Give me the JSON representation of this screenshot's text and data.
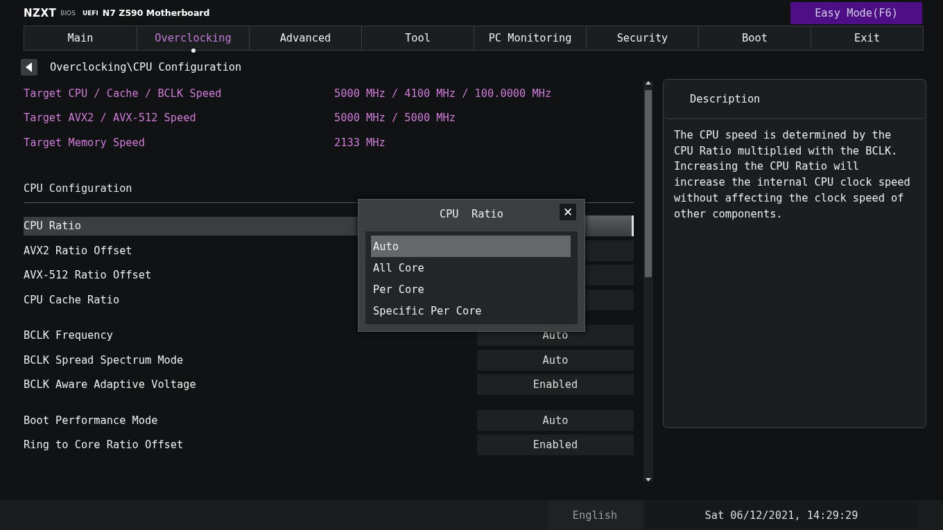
{
  "header": {
    "brand": "NZXT",
    "bios": "BIOS",
    "uefi": "UEFI",
    "board": "N7 Z590 Motherboard",
    "easy_mode": "Easy Mode(F6)"
  },
  "tabs": [
    {
      "label": "Main",
      "selected": false
    },
    {
      "label": "Overclocking",
      "selected": true
    },
    {
      "label": "Advanced",
      "selected": false
    },
    {
      "label": "Tool",
      "selected": false
    },
    {
      "label": "PC Monitoring",
      "selected": false
    },
    {
      "label": "Security",
      "selected": false
    },
    {
      "label": "Boot",
      "selected": false
    },
    {
      "label": "Exit",
      "selected": false
    }
  ],
  "breadcrumb": "Overclocking\\CPU Configuration",
  "info": [
    {
      "label": "Target CPU / Cache / BCLK Speed",
      "value": "5000 MHz / 4100 MHz / 100.0000 MHz"
    },
    {
      "label": "Target AVX2 / AVX-512 Speed",
      "value": "5000 MHz / 5000 MHz"
    },
    {
      "label": "Target Memory Speed",
      "value": "2133 MHz"
    }
  ],
  "section": "CPU Configuration",
  "groups": [
    [
      {
        "label": "CPU  Ratio",
        "selected": true
      },
      {
        "label": "AVX2 Ratio Offset",
        "selected": false
      },
      {
        "label": "AVX-512 Ratio Offset",
        "selected": false
      },
      {
        "label": "CPU  Cache Ratio",
        "selected": false
      }
    ],
    [
      {
        "label": "BCLK Frequency",
        "value": "Auto",
        "selected": false
      },
      {
        "label": "BCLK Spread Spectrum Mode",
        "value": "Auto",
        "selected": false
      },
      {
        "label": "BCLK Aware Adaptive Voltage",
        "value": "Enabled",
        "selected": false
      }
    ],
    [
      {
        "label": "Boot Performance Mode",
        "value": "Auto",
        "selected": false
      },
      {
        "label": "Ring to Core Ratio Offset",
        "value": "Enabled",
        "selected": false
      }
    ]
  ],
  "popup": {
    "title": "CPU  Ratio",
    "close": "✕",
    "options": [
      {
        "label": "Auto",
        "selected": true
      },
      {
        "label": "All Core",
        "selected": false
      },
      {
        "label": "Per Core",
        "selected": false
      },
      {
        "label": "Specific Per Core",
        "selected": false
      }
    ]
  },
  "description": {
    "title": "Description",
    "text": "The CPU speed is determined by the CPU Ratio multiplied with the BCLK. Increasing the CPU Ratio will increase the internal CPU clock speed without affecting the clock speed of other components."
  },
  "footer": {
    "language": "English",
    "datetime": "Sat 06/12/2021, 14:29:29"
  }
}
